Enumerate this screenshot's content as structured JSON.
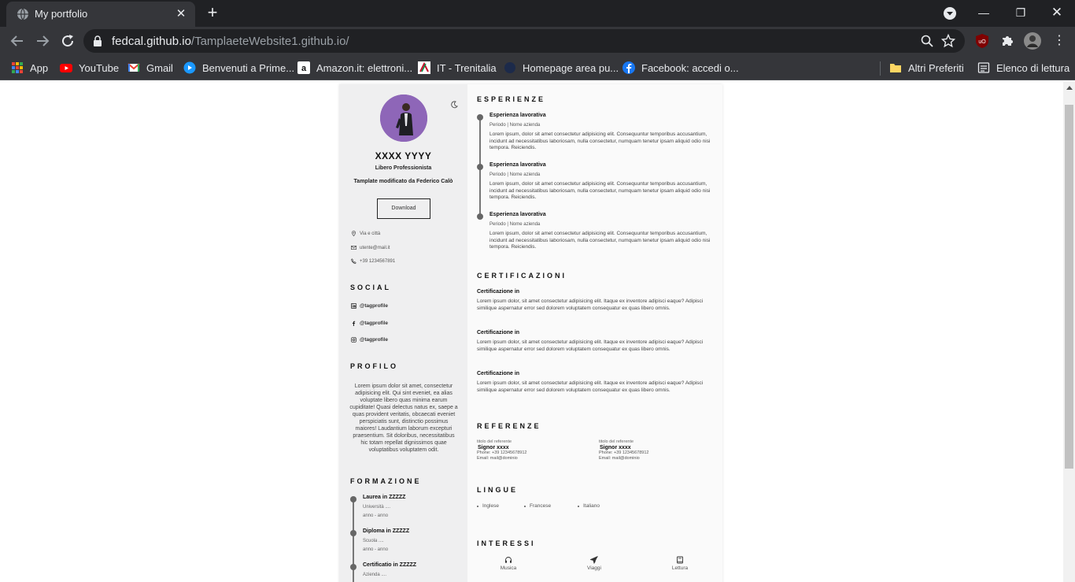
{
  "browser": {
    "tab_title": "My portfolio",
    "url_host": "fedcal.github.io",
    "url_path": "/TamplaeteWebsite1.github.io/",
    "bookmarks": [
      {
        "label": "App",
        "icon": "apps-grid-icon"
      },
      {
        "label": "YouTube",
        "icon": "youtube-icon"
      },
      {
        "label": "Gmail",
        "icon": "gmail-icon"
      },
      {
        "label": "Benvenuti a Prime...",
        "icon": "prime-icon"
      },
      {
        "label": "Amazon.it: elettroni...",
        "icon": "amazon-icon"
      },
      {
        "label": "IT - Trenitalia",
        "icon": "trenitalia-icon"
      },
      {
        "label": "Homepage area pu...",
        "icon": "homepage-icon"
      },
      {
        "label": "Facebook: accedi o...",
        "icon": "facebook-icon"
      },
      {
        "label": "Altri Preferiti",
        "icon": "folder-icon"
      },
      {
        "label": "Elenco di lettura",
        "icon": "reading-list-icon"
      }
    ]
  },
  "sidebar": {
    "name": "XXXX YYYY",
    "role": "Libero Professionista",
    "template_note": "Tamplate modificato da Federico Calò",
    "download_label": "Download",
    "contacts": [
      {
        "icon": "location-pin-icon",
        "text": "Via e città"
      },
      {
        "icon": "mail-icon",
        "text": "utente@mail.it"
      },
      {
        "icon": "phone-icon",
        "text": "+39 1234567891"
      }
    ],
    "social_title": "SOCIAL",
    "social": [
      {
        "icon": "linkedin-icon",
        "text": "@tagprofile"
      },
      {
        "icon": "facebook-icon",
        "text": "@tagprofile"
      },
      {
        "icon": "instagram-icon",
        "text": "@tagprofile"
      }
    ],
    "profile_title": "PROFILO",
    "profile_text": "Lorem ipsum dolor sit amet, consectetur adipisicing elit. Qui sint eveniet, ea alias voluptate libero quas minima earum cupiditate! Quasi delectus natus ex, saepe a quas provident veritatis, obcaecati eveniet perspiciatis sunt, distinctio possimus maiores! Laudantium laborum excepturi praesentium. Sit doloribus, necessitatibus hic totam repellat dignissimos quae voluptatibus voluptatem odit.",
    "education_title": "FORMAZIONE",
    "education": [
      {
        "title": "Laurea in ZZZZZ",
        "place": "Università ....",
        "years": "anno - anno"
      },
      {
        "title": "Diploma in ZZZZZ",
        "place": "Scuola ....",
        "years": "anno - anno"
      },
      {
        "title": "Certificatio in ZZZZZ",
        "place": "Azienda ....",
        "years": ""
      }
    ]
  },
  "main": {
    "experience_title": "ESPERIENZE",
    "experiences": [
      {
        "title": "Esperienza lavorativa",
        "sub": "Periodo | Nome azienda",
        "body": "Lorem ipsum, dolor sit amet consectetur adipisicing elit. Consequuntur temporibus accusantium, incidunt ad necessitatibus laboriosam, nulla consectetur, numquam tenetur ipsam aliquid odio nisi tempora. Reiciendis."
      },
      {
        "title": "Esperienza lavorativa",
        "sub": "Periodo | Nome azienda",
        "body": "Lorem ipsum, dolor sit amet consectetur adipisicing elit. Consequuntur temporibus accusantium, incidunt ad necessitatibus laboriosam, nulla consectetur, numquam tenetur ipsam aliquid odio nisi tempora. Reiciendis."
      },
      {
        "title": "Esperienza lavorativa",
        "sub": "Periodo | Nome azienda",
        "body": "Lorem ipsum, dolor sit amet consectetur adipisicing elit. Consequuntur temporibus accusantium, incidunt ad necessitatibus laboriosam, nulla consectetur, numquam tenetur ipsam aliquid odio nisi tempora. Reiciendis."
      }
    ],
    "cert_title": "CERTIFICAZIONI",
    "certifications": [
      {
        "title": "Certificazione in",
        "body": "Lorem ipsum dolor, sit amet consectetur adipisicing elit. Itaque ex inventore adipisci eaque? Adipisci similique aspernatur error sed dolorem voluptatem consequatur ex quas libero omnis."
      },
      {
        "title": "Certificazione in",
        "body": "Lorem ipsum dolor, sit amet consectetur adipisicing elit. Itaque ex inventore adipisci eaque? Adipisci similique aspernatur error sed dolorem voluptatem consequatur ex quas libero omnis."
      },
      {
        "title": "Certificazione in",
        "body": "Lorem ipsum dolor, sit amet consectetur adipisicing elit. Itaque ex inventore adipisci eaque? Adipisci similique aspernatur error sed dolorem voluptatem consequatur ex quas libero omnis."
      }
    ],
    "ref_title": "REFERENZE",
    "references": [
      {
        "label": "titolo del referente",
        "name": "Signor xxxx",
        "phone": "Phone: +39 12345678912",
        "email": "Email: mail@dominio"
      },
      {
        "label": "titolo del referente",
        "name": "Signor xxxx",
        "phone": "Phone: +39 12345678912",
        "email": "Email: mail@dominio"
      }
    ],
    "lang_title": "LINGUE",
    "languages": [
      "Inglese",
      "Francese",
      "Italiano"
    ],
    "interests_title": "INTERESSI",
    "interests": [
      {
        "icon": "headphones-icon",
        "label": "Musica"
      },
      {
        "icon": "airplane-icon",
        "label": "Viaggi"
      },
      {
        "icon": "book-icon",
        "label": "Lettura"
      }
    ]
  }
}
